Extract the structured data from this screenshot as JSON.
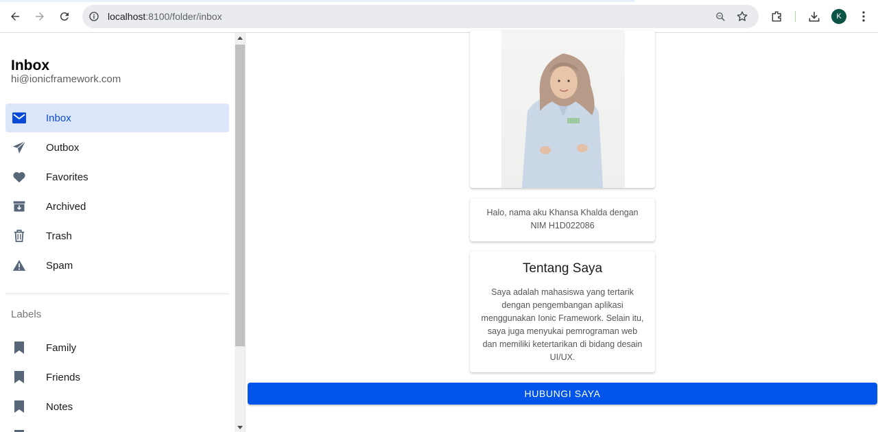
{
  "browser": {
    "url_host": "localhost",
    "url_path": ":8100/folder/inbox",
    "avatar_initial": "K"
  },
  "menu": {
    "title": "Inbox",
    "subtitle": "hi@ionicframework.com",
    "items": [
      {
        "label": "Inbox",
        "icon": "mail-icon"
      },
      {
        "label": "Outbox",
        "icon": "paper-plane-icon"
      },
      {
        "label": "Favorites",
        "icon": "heart-icon"
      },
      {
        "label": "Archived",
        "icon": "archive-icon"
      },
      {
        "label": "Trash",
        "icon": "trash-icon"
      },
      {
        "label": "Spam",
        "icon": "warning-icon"
      }
    ],
    "labels_header": "Labels",
    "labels": [
      {
        "label": "Family",
        "icon": "bookmark-icon"
      },
      {
        "label": "Friends",
        "icon": "bookmark-icon"
      },
      {
        "label": "Notes",
        "icon": "bookmark-icon"
      }
    ]
  },
  "profile": {
    "greeting": "Halo, nama aku Khansa Khalda dengan NIM H1D022086",
    "about_title": "Tentang Saya",
    "about_body": "Saya adalah mahasiswa yang tertarik dengan pengembangan aplikasi menggunakan Ionic Framework. Selain itu, saya juga menyukai pemrograman web dan memiliki ketertarikan di bidang desain UI/UX.",
    "contact_button": "HUBUNGI SAYA"
  },
  "colors": {
    "primary": "#0054e9",
    "active_bg": "#dce6fb",
    "icon_gray": "#58667a"
  }
}
